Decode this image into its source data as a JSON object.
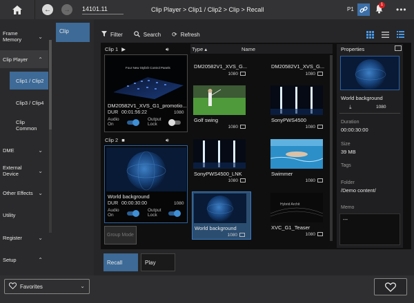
{
  "topbar": {
    "ip_value": "14101.11",
    "breadcrumb": "Clip Player > Clip1 / Clip2 > Clip > Recall",
    "page_indicator": "P1",
    "notification_count": "1",
    "more_label": "•••"
  },
  "sidebar": {
    "items": [
      {
        "label": "Frame\nMemory"
      },
      {
        "label": "Clip Player"
      },
      {
        "label": "DME"
      },
      {
        "label": "External\nDevice"
      },
      {
        "label": "Other Effects"
      },
      {
        "label": "Utility"
      },
      {
        "label": "Register"
      },
      {
        "label": "Setup"
      }
    ],
    "subitems": [
      {
        "label": "Clip1 / Clip2"
      },
      {
        "label": "Clip3 / Clip4"
      },
      {
        "label": "Clip\nCommon"
      }
    ]
  },
  "subnav": {
    "tab_label": "Clip"
  },
  "toolbar": {
    "filter_label": "Filter",
    "search_label": "Search",
    "refresh_label": "Refresh"
  },
  "clip1": {
    "header": "Clip 1",
    "thumb_caption": "Four New Stylish Control Panels",
    "name": "DM20582V1_XVS_G1_promotio...",
    "dur_label": "DUR",
    "duration": "00:01:56:22",
    "resolution": "1080",
    "audio_label": "Audio\nOn",
    "output_label": "Output\nLock",
    "audio_on": true,
    "output_lock": false
  },
  "clip2": {
    "header": "Clip 2",
    "name": "World background",
    "dur_label": "DUR",
    "duration": "00:00:30:00",
    "resolution": "1080",
    "audio_label": "Audio\nOn",
    "output_label": "Output\nLock",
    "audio_on": true,
    "output_lock": true
  },
  "group_mode_label": "Group Mode",
  "grid": {
    "col_type": "Type",
    "col_name": "Name",
    "items": [
      {
        "name": "DM20582V1_XVS_G...",
        "res": "1080"
      },
      {
        "name": "DM20582V1_XVS_G...",
        "res": "1080"
      },
      {
        "name": "Golf swing",
        "res": "1080"
      },
      {
        "name": "SonyPWS4500",
        "res": "1080"
      },
      {
        "name": "SonyPWS4500_LNK",
        "res": "1080"
      },
      {
        "name": "Swimmer",
        "res": "1080"
      },
      {
        "name": "World background",
        "res": "1080"
      },
      {
        "name": "XVC_G1_Teaser",
        "res": "1080"
      }
    ],
    "teaser_overlay": "Hybrid Archit"
  },
  "properties": {
    "title": "Properties",
    "name": "World background",
    "resolution": "1080",
    "duration_label": "Duration",
    "duration": "00:00:30:00",
    "size_label": "Size",
    "size": "39 MB",
    "tags_label": "Tags",
    "folder_label": "Folder",
    "folder": "/Demo content/",
    "memo_label": "Memo",
    "memo": "---"
  },
  "actions": {
    "recall_label": "Recall",
    "play_label": "Play"
  },
  "footer": {
    "favorites_label": "Favorites"
  },
  "colors": {
    "accent": "#3d6a97",
    "toggle_on": "#3f8fd6",
    "badge": "#d82020"
  }
}
